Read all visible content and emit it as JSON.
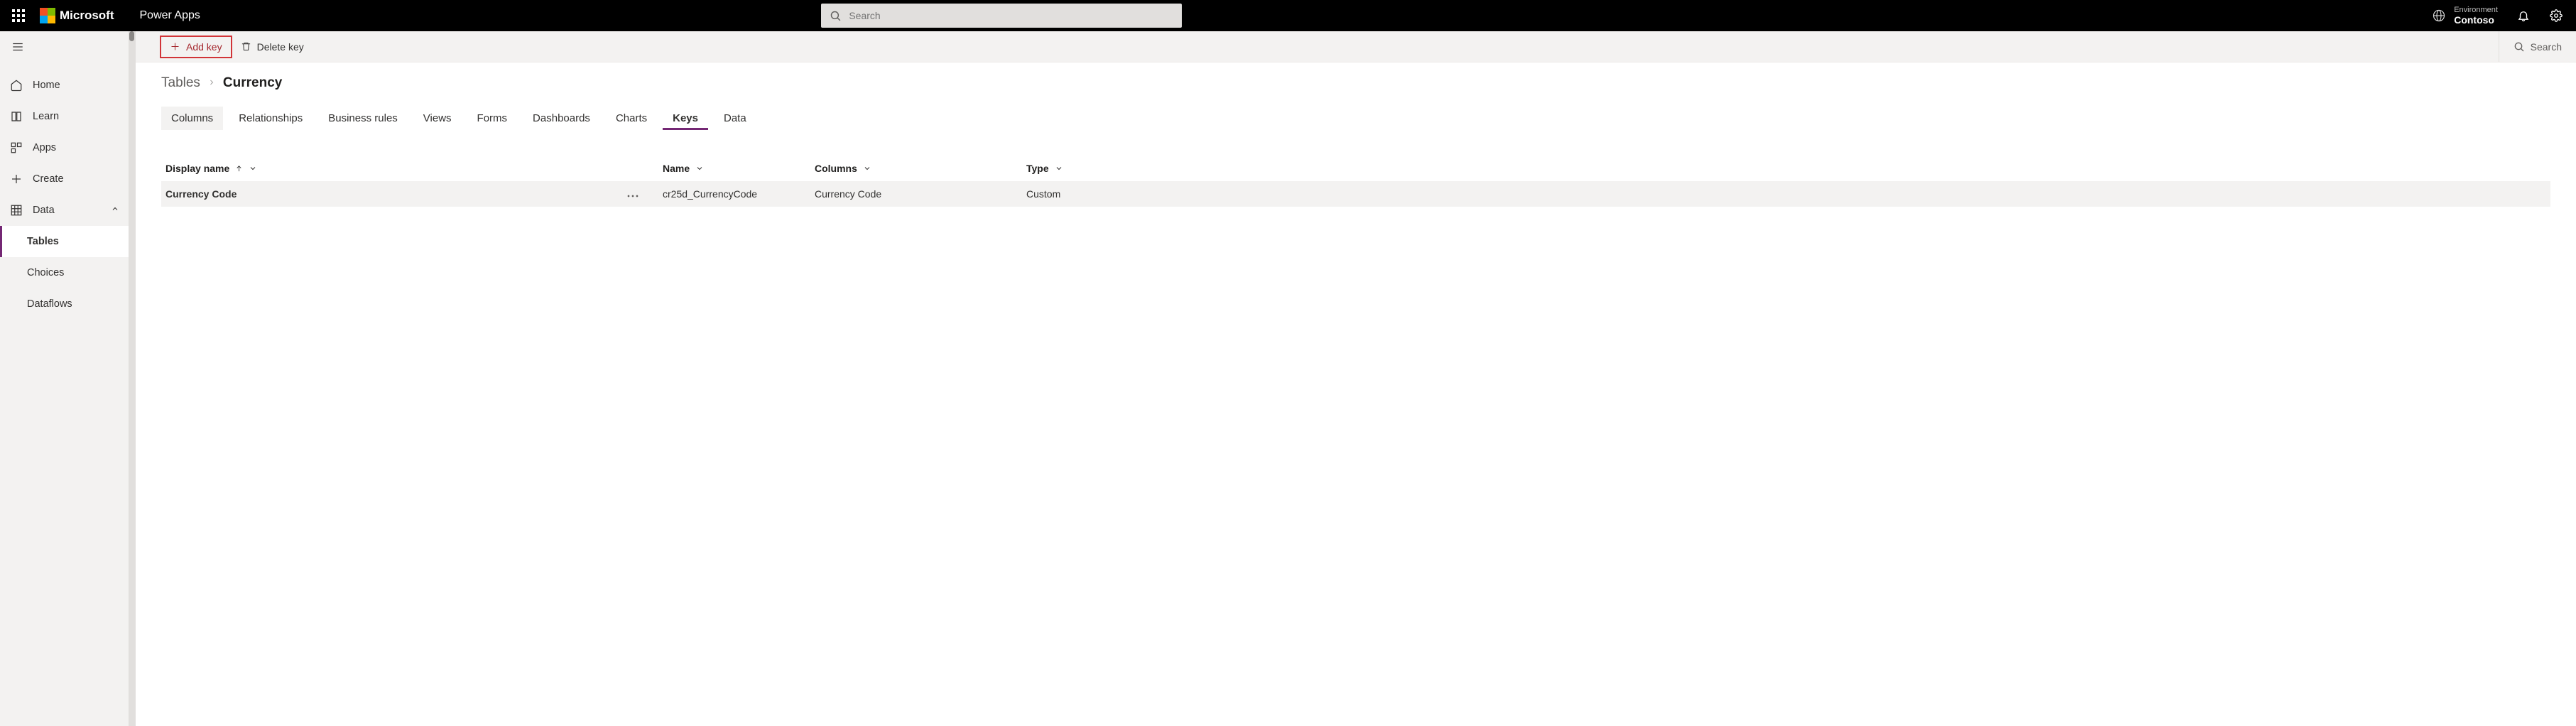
{
  "header": {
    "brand": "Microsoft",
    "app": "Power Apps",
    "search_placeholder": "Search",
    "env_label": "Environment",
    "env_name": "Contoso"
  },
  "leftnav": {
    "home": "Home",
    "learn": "Learn",
    "apps": "Apps",
    "create": "Create",
    "data": "Data",
    "tables": "Tables",
    "choices": "Choices",
    "dataflows": "Dataflows"
  },
  "commands": {
    "add_key": "Add key",
    "delete_key": "Delete key",
    "search": "Search"
  },
  "breadcrumb": {
    "root": "Tables",
    "current": "Currency"
  },
  "tabs": {
    "columns": "Columns",
    "relationships": "Relationships",
    "business_rules": "Business rules",
    "views": "Views",
    "forms": "Forms",
    "dashboards": "Dashboards",
    "charts": "Charts",
    "keys": "Keys",
    "data": "Data"
  },
  "table": {
    "headers": {
      "display_name": "Display name",
      "name": "Name",
      "columns": "Columns",
      "type": "Type"
    },
    "rows": [
      {
        "display_name": "Currency Code",
        "name": "cr25d_CurrencyCode",
        "columns": "Currency Code",
        "type": "Custom"
      }
    ]
  }
}
